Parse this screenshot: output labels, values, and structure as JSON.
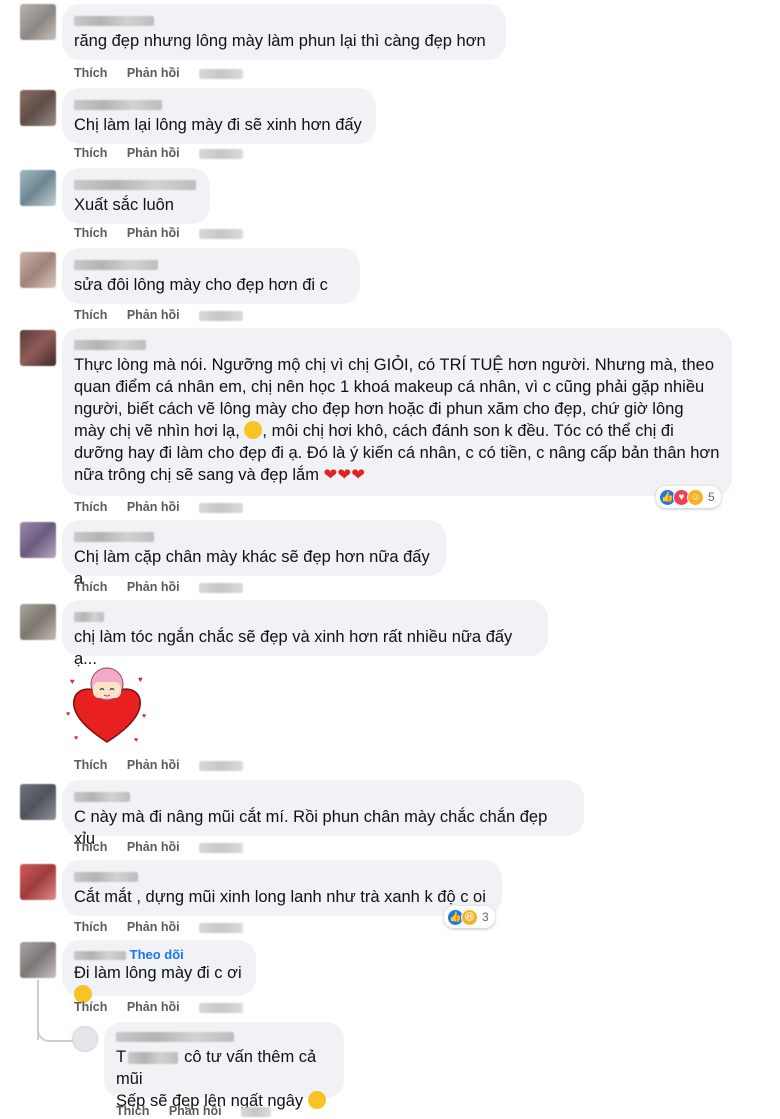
{
  "labels": {
    "like": "Thích",
    "reply": "Phản hồi",
    "follow": "Theo dõi"
  },
  "comments": [
    {
      "text": "răng đẹp nhưng lông mày làm phun lại thì càng đẹp hơn"
    },
    {
      "text": "Chị làm lại lông mày đi sẽ xinh hơn đấy"
    },
    {
      "text": "Xuất sắc luôn"
    },
    {
      "text": "sửa đôi lông mày cho đẹp hơn đi c"
    },
    {
      "lines": [
        "Thực lòng mà nói. Ngưỡng mộ chị vì chị GIỎI, có TRÍ TUỆ hơn người. Nhưng mà, theo",
        "quan điểm cá nhân em, chị nên học 1 khoá makeup cá nhân, vì c cũng phải gặp nhiều",
        "người, biết cách vẽ lông mày cho đẹp hơn hoặc đi phun xăm cho đẹp, chứ giờ lông",
        "mày chị vẽ nhìn hơi lạ,",
        ", môi chị hơi khô, cách đánh son k đều. Tóc có thể chị đi",
        "dưỡng hay đi làm cho đẹp đi ạ. Đó là ý kiến cá nhân, c có tiền, c nâng cấp bản thân hơn",
        "nữa trông chị sẽ sang và đẹp lắm"
      ],
      "reaction_count": "5"
    },
    {
      "text": "Chị làm cặp chân mày khác sẽ đẹp hơn nữa đấy ạ"
    },
    {
      "text": "chị làm tóc ngắn chắc sẽ đẹp và xinh hơn rất nhiều nữa đấy ạ..."
    },
    {
      "text": "C này mà đi nâng mũi cắt mí. Rồi phun chân mày chắc chắn đẹp xỉu"
    },
    {
      "text": "Cắt mắt , dựng mũi xinh long lanh như trà xanh k độ c oi",
      "reaction_count": "3"
    },
    {
      "text": "Đi làm lông mày đi c ơi"
    },
    {
      "prefix": "T",
      "line1": "cô tư vấn thêm cả mũi",
      "line2": "Sếp sẽ đẹp lên ngất ngây"
    }
  ],
  "colors": {
    "bubble": "#f0f2f5",
    "link": "#1877f2",
    "heart": "#e02424"
  }
}
